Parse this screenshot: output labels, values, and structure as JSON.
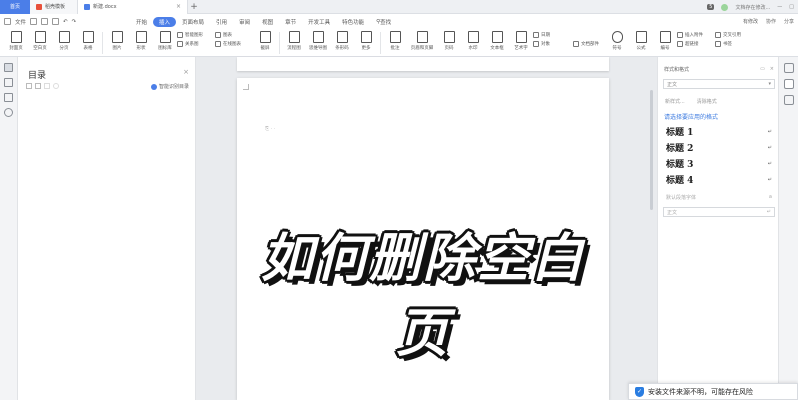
{
  "titlebar": {
    "home": "首页",
    "tab_template": "稻壳模板",
    "tab_doc": "新建.docx",
    "right_text": "文档存在修改...",
    "count": "5"
  },
  "menubar": {
    "file": "文件",
    "items": [
      "开始",
      "插入",
      "页面布局",
      "引用",
      "审阅",
      "视图",
      "章节",
      "开发工具",
      "特色功能"
    ],
    "search": "查找",
    "right": [
      "有修改",
      "协作",
      "分享"
    ]
  },
  "ribbon": {
    "big": [
      "封面页",
      "空白页",
      "分页",
      "表格",
      "图片",
      "形状",
      "图标库"
    ],
    "pairs": [
      [
        "智能图形",
        "关系图"
      ],
      [
        "图表",
        "在线图表"
      ]
    ],
    "big2": [
      "截屏",
      "流程图",
      "思维导图",
      "条形码",
      "更多",
      "批注",
      "页眉和页脚",
      "页码",
      "水印",
      "文本框",
      "艺术字",
      "对象",
      "文档部件",
      "符号",
      "公式",
      "编号"
    ],
    "right_pairs": [
      [
        "插入附件",
        "超链接"
      ],
      [
        "交叉引用",
        "书签"
      ]
    ],
    "date": "日期"
  },
  "toc": {
    "title": "目录",
    "smart": "智能识别目录"
  },
  "document": {
    "headline": "如何删除空白页"
  },
  "styles": {
    "title": "样式和格式",
    "current": "正文",
    "new_style": "新样式...",
    "clear_format": "清除格式",
    "apply_label": "请选择要应用的格式",
    "headings": [
      "标题 1",
      "标题 2",
      "标题 3",
      "标题 4"
    ],
    "default_font": "默认段落字体",
    "body": "正文",
    "return_mark": "↵",
    "sharp_mark": "a"
  },
  "notice": {
    "text": "安装文件来源不明，可能存在风险"
  }
}
